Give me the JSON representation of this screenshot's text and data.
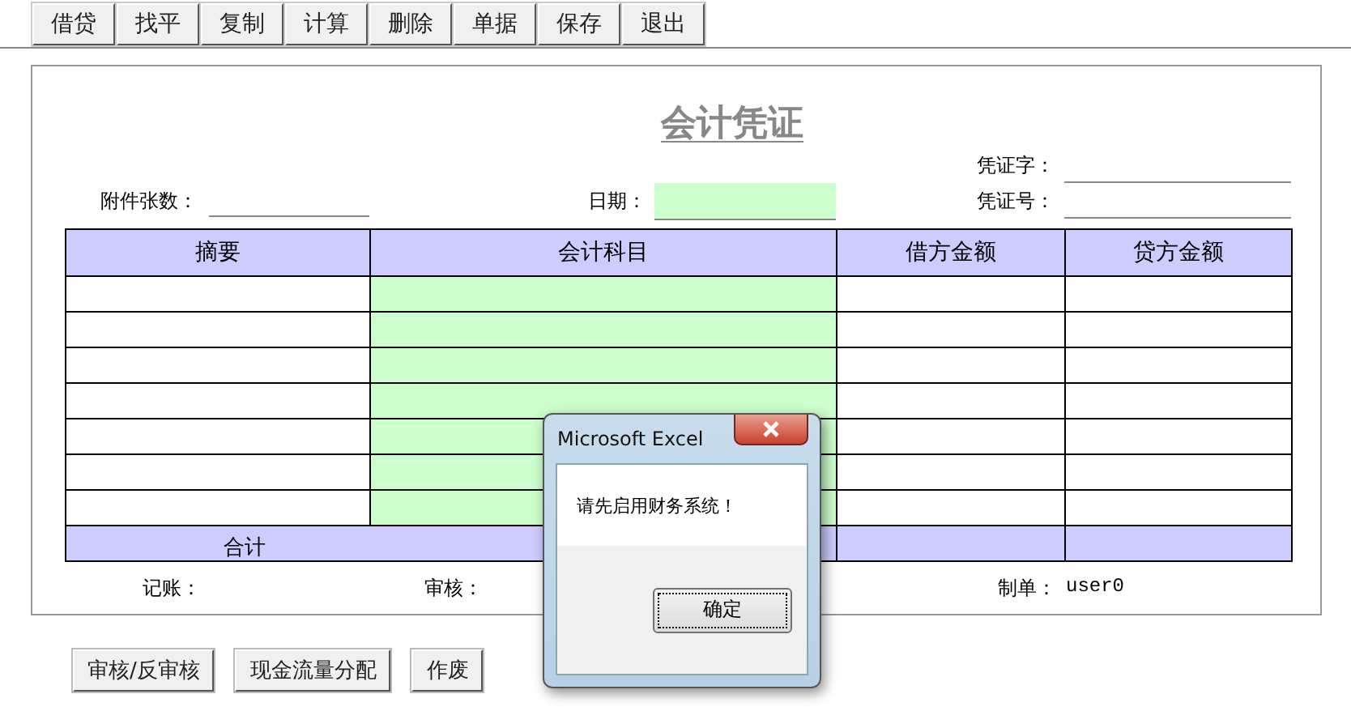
{
  "toolbar": [
    {
      "label": "借贷"
    },
    {
      "label": "找平"
    },
    {
      "label": "复制"
    },
    {
      "label": "计算"
    },
    {
      "label": "删除"
    },
    {
      "label": "单据"
    },
    {
      "label": "保存"
    },
    {
      "label": "退出"
    }
  ],
  "voucher": {
    "title": "会计凭证",
    "voucher_word_label": "凭证字：",
    "attachments_label": "附件张数：",
    "date_label": "日期：",
    "voucher_number_label": "凭证号："
  },
  "table": {
    "columns": [
      {
        "label": "摘要",
        "kind": "text"
      },
      {
        "label": "会计科目",
        "kind": "input"
      },
      {
        "label": "借方金额",
        "kind": "amount"
      },
      {
        "label": "贷方金额",
        "kind": "amount"
      }
    ],
    "rows": [
      {
        "kind": "blank"
      },
      {
        "kind": "blank"
      },
      {
        "kind": "blank"
      },
      {
        "kind": "blank"
      },
      {
        "kind": "blank"
      },
      {
        "kind": "blank"
      },
      {
        "kind": "blank"
      }
    ],
    "total_label": "合计"
  },
  "signatures": {
    "bookkeeper_label": "记账：",
    "reviewer_label": "审核：",
    "maker_label": "制单：",
    "maker_value": "user0"
  },
  "actions": [
    {
      "label": "审核/反审核"
    },
    {
      "label": "现金流量分配"
    },
    {
      "label": "作废"
    }
  ],
  "dialog": {
    "title": "Microsoft Excel",
    "message": "请先启用财务系统！",
    "button": "确定"
  }
}
